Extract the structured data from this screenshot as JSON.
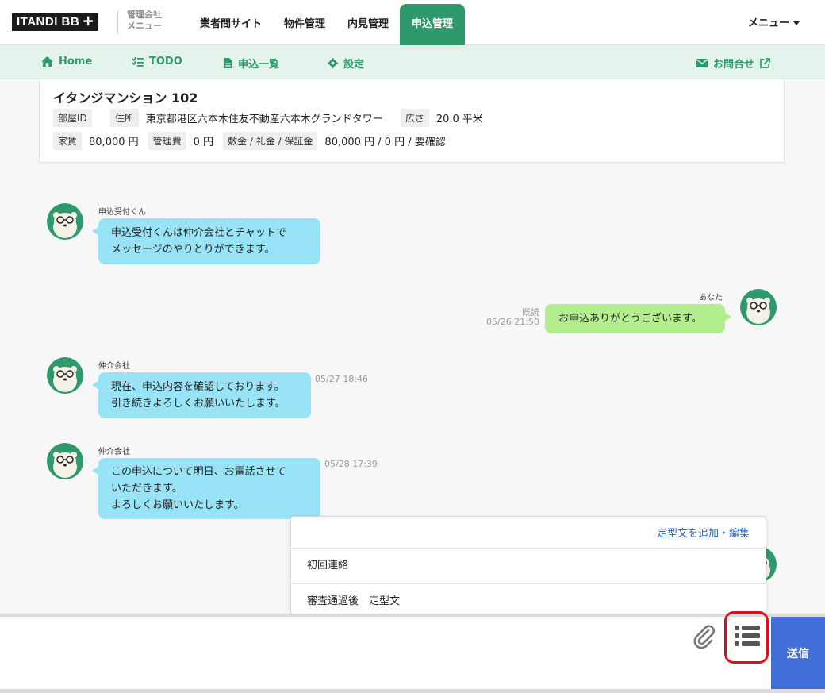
{
  "header": {
    "logo_text": "ITANDI BB",
    "logo_sub_1": "管理会社",
    "logo_sub_2": "メニュー",
    "nav": [
      "業者間サイト",
      "物件管理",
      "内見管理",
      "申込管理"
    ],
    "active_nav": "申込管理",
    "menu_label": "メニュー"
  },
  "subnav": {
    "home": "Home",
    "todo": "TODO",
    "list": "申込一覧",
    "settings": "設定",
    "contact": "お問合せ"
  },
  "property": {
    "title": "イタンジマンション 102",
    "room_id_label": "部屋ID",
    "room_id": "",
    "address_label": "住所",
    "address": "東京都港区六本木住友不動産六本木グランドタワー",
    "area_label": "広さ",
    "area": "20.0 平米",
    "rent_label": "家賃",
    "rent": "80,000 円",
    "mgmt_label": "管理費",
    "mgmt": "0 円",
    "deposit_label": "敷金 / 礼金 / 保証金",
    "deposit": "80,000 円 / 0 円 / 要確認"
  },
  "messages": [
    {
      "sender": "申込受付くん",
      "line1": "申込受付くんは仲介会社とチャットで",
      "line2": "メッセージのやりとりができます。",
      "time": ""
    },
    {
      "sender": "あなた",
      "text": "お申込ありがとうございます。",
      "read": "既読",
      "time": "05/26 21:50"
    },
    {
      "sender": "仲介会社",
      "line1": "現在、申込内容を確認しております。",
      "line2": "引き続きよろしくお願いいたします。",
      "time": "05/27 18:46"
    },
    {
      "sender": "仲介会社",
      "line1": "この申込について明日、お電話させて",
      "line2": "いただきます。",
      "line3": "よろしくお願いいたします。",
      "time": "05/28 17:39"
    }
  ],
  "template_popup": {
    "edit_link": "定型文を追加・編集",
    "items": [
      "初回連絡",
      "審査通過後　定型文"
    ]
  },
  "composer": {
    "placeholder": "",
    "send_label": "送信"
  },
  "colors": {
    "brand_green": "#2e9a6b",
    "subnav_bg": "#e4f4ec",
    "bubble_blue": "#98e3f5",
    "bubble_green": "#b3ee8e",
    "send_blue": "#3f6fd7",
    "highlight_red": "#d8101d"
  }
}
